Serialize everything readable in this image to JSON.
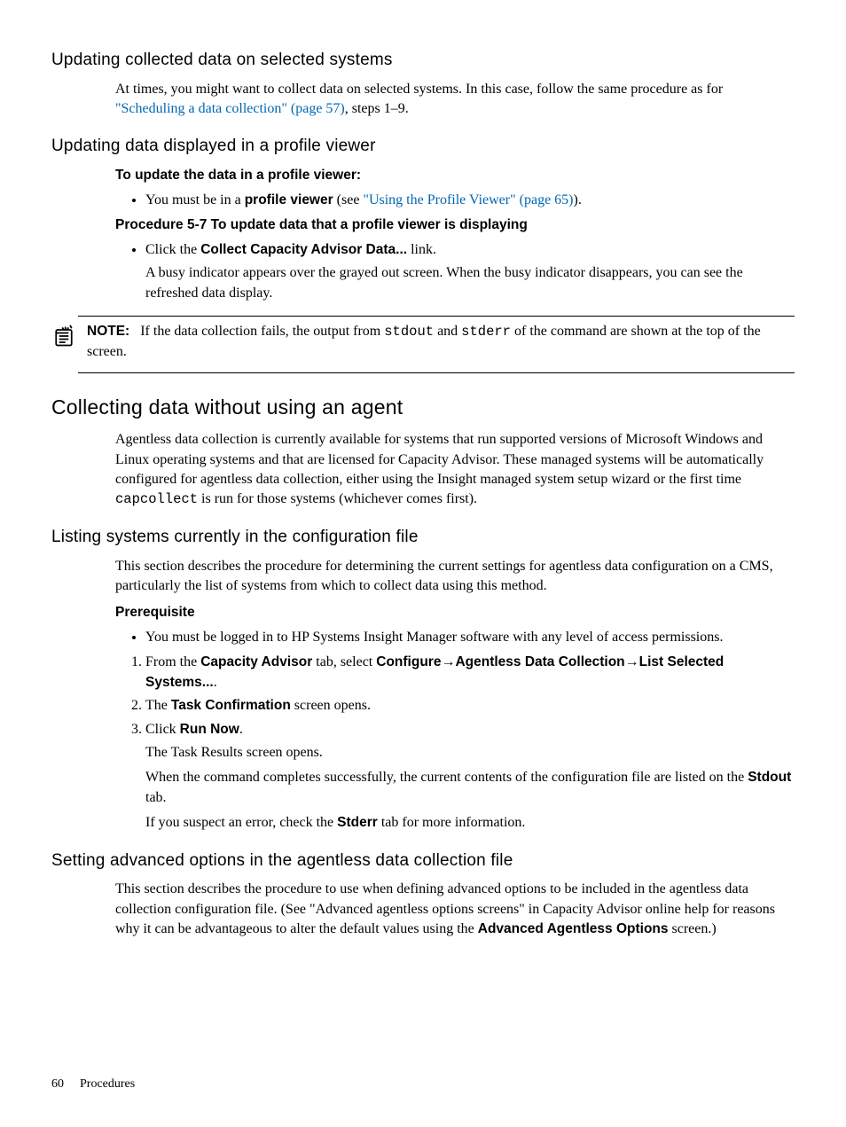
{
  "sec1": {
    "title": "Updating collected data on selected systems",
    "para_pre": "At times, you might want to collect data on selected systems. In this case, follow the same procedure as for ",
    "link": "\"Scheduling a data collection\" (page 57)",
    "para_post": ", steps 1–9."
  },
  "sec2": {
    "title": "Updating data displayed in a profile viewer",
    "lead": "To update the data in a profile viewer:",
    "bullet1_pre": "You must be in a ",
    "bullet1_bold": "profile viewer",
    "bullet1_mid": " (see ",
    "bullet1_link": "\"Using the Profile Viewer\" (page 65)",
    "bullet1_post": ").",
    "proc_title": "Procedure 5-7 To update data that a profile viewer is displaying",
    "p1_pre": "Click the ",
    "p1_bold": "Collect Capacity Advisor Data...",
    "p1_post": " link.",
    "p1_sub": "A busy indicator appears over the grayed out screen. When the busy indicator disappears, you can see the refreshed data display.",
    "note_label": "NOTE:",
    "note_pre": "If the data collection fails, the output from ",
    "note_c1": "stdout",
    "note_mid": " and ",
    "note_c2": "stderr",
    "note_post": " of the command are shown at the top of the screen."
  },
  "sec3": {
    "title": "Collecting data without using an agent",
    "para_a": "Agentless data collection is currently available for systems that run supported versions of Microsoft Windows and Linux operating systems and that are licensed for Capacity Advisor. These managed systems will be automatically configured for agentless data collection, either using the Insight managed system setup wizard or the first time ",
    "para_code": "capcollect",
    "para_b": " is run for those systems (whichever comes first)."
  },
  "sec4": {
    "title": "Listing systems currently in the configuration file",
    "intro": "This section describes the procedure for determining the current settings for agentless data configuration on a CMS, particularly the list of systems from which to collect data using this method.",
    "prereq_label": "Prerequisite",
    "prereq_bullet": "You must be logged in to HP Systems Insight Manager software with any level of access permissions.",
    "s1_a": "From the ",
    "s1_b": "Capacity Advisor",
    "s1_c": " tab, select ",
    "s1_d": "Configure",
    "arrow": "→",
    "s1_e": "Agentless Data Collection",
    "s1_f": "List Selected Systems...",
    "s1_end": ".",
    "s2_a": "The ",
    "s2_b": "Task Confirmation",
    "s2_c": " screen opens.",
    "s3_a": "Click ",
    "s3_b": "Run Now",
    "s3_c": ".",
    "s3_sub1": "The Task Results screen opens.",
    "s3_sub2_a": "When the command completes successfully, the current contents of the configuration file are listed on the ",
    "s3_sub2_b": "Stdout",
    "s3_sub2_c": " tab.",
    "s3_sub3_a": "If you suspect an error, check the ",
    "s3_sub3_b": "Stderr",
    "s3_sub3_c": " tab for more information."
  },
  "sec5": {
    "title": "Setting advanced options in the agentless data collection file",
    "para_a": "This section describes the procedure to use when defining advanced options to be included in the agentless data collection configuration file. (See \"Advanced agentless options screens\" in Capacity Advisor online help for reasons why it can be advantageous to alter the default values using the ",
    "para_bold": "Advanced Agentless Options",
    "para_b": " screen.)"
  },
  "footer": {
    "page": "60",
    "section": "Procedures"
  }
}
